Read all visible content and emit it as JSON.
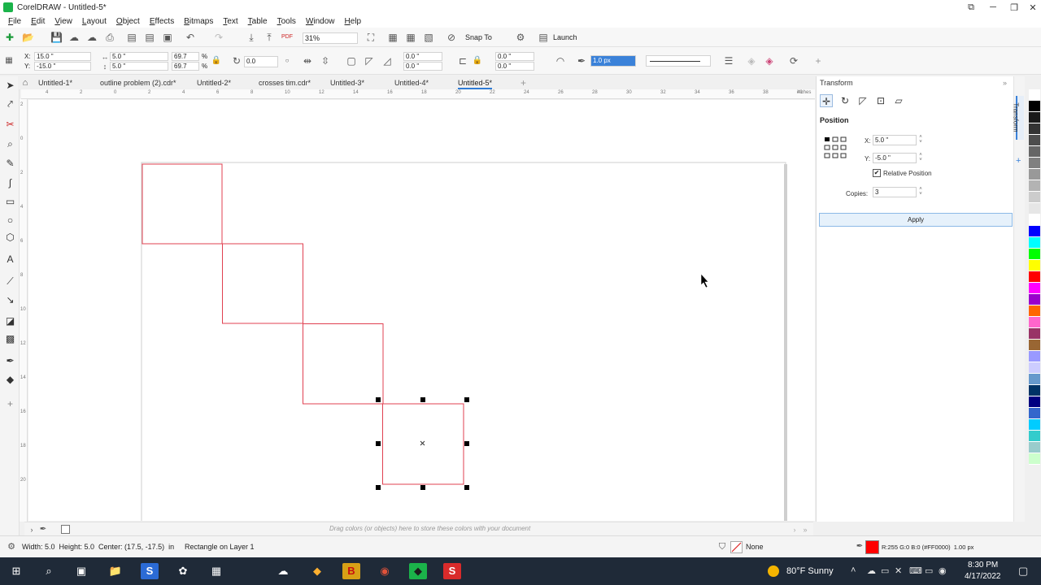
{
  "window": {
    "title": "CorelDRAW - Untitled-5*",
    "controls": {
      "maximize": "⧉",
      "minimize": "─",
      "restore": "❐",
      "close": "✕"
    }
  },
  "menu": [
    "File",
    "Edit",
    "View",
    "Layout",
    "Object",
    "Effects",
    "Bitmaps",
    "Text",
    "Table",
    "Tools",
    "Window",
    "Help"
  ],
  "toolbar": {
    "zoom": "31%",
    "snap_to": "Snap To",
    "launch": "Launch",
    "icons": {
      "new": "✚",
      "open": "📂",
      "save": "💾",
      "undo": "↶",
      "redo": "↷",
      "settings": "⚙",
      "pdf": "PDF"
    }
  },
  "property_bar": {
    "x": "15.0 \"",
    "y": "-15.0 \"",
    "width": "5.0 \"",
    "height": "5.0 \"",
    "scale_w": "69.7",
    "scale_h": "69.7",
    "percent_sign": "%",
    "rotation": "0.0",
    "corner_tl": "0.0 \"",
    "corner_bl": "0.0 \"",
    "corner_tr": "0.0 \"",
    "corner_br": "0.0 \"",
    "outline_width": "1.0 px"
  },
  "doc_tabs": [
    {
      "label": "Untitled-1*",
      "active": false
    },
    {
      "label": "outline problem (2).cdr*",
      "active": false
    },
    {
      "label": "Untitled-2*",
      "active": false
    },
    {
      "label": "crosses tim.cdr*",
      "active": false
    },
    {
      "label": "Untitled-3*",
      "active": false
    },
    {
      "label": "Untitled-4*",
      "active": false
    },
    {
      "label": "Untitled-5*",
      "active": true
    }
  ],
  "add_tab": "+",
  "ruler": {
    "h_ticks": [
      "4",
      "2",
      "0",
      "2",
      "4",
      "6",
      "8",
      "10",
      "12",
      "14",
      "16",
      "18",
      "20",
      "22",
      "24",
      "26",
      "28",
      "30",
      "32",
      "34",
      "36",
      "38",
      "40"
    ],
    "v_ticks": [
      "2",
      "0",
      "2",
      "4",
      "6",
      "8",
      "10",
      "12",
      "14",
      "16",
      "18",
      "20"
    ],
    "unit": "inches"
  },
  "docker": {
    "title": "Transform",
    "section": "Position",
    "x_label": "X:",
    "x_value": "5.0 \"",
    "y_label": "Y:",
    "y_value": "-5.0 \"",
    "relative_label": "Relative Position",
    "relative_checked": true,
    "copies_label": "Copies:",
    "copies_value": "3",
    "apply_label": "Apply",
    "side_tab": "Transform"
  },
  "color_tray": {
    "hint": "Drag colors (or objects) here to store these colors with your document"
  },
  "palette_colors": [
    "#ffffff",
    "#000000",
    "#1a1a1a",
    "#333333",
    "#4d4d4d",
    "#666666",
    "#808080",
    "#999999",
    "#b3b3b3",
    "#cccccc",
    "#e6e6e6",
    "#ffffff",
    "#0000ff",
    "#00ffff",
    "#00ff00",
    "#ffff00",
    "#ff0000",
    "#ff00ff",
    "#9900cc",
    "#ff6600",
    "#ff66cc",
    "#993366",
    "#996633",
    "#9999ff",
    "#ccccff",
    "#6699cc",
    "#003366",
    "#000080",
    "#3366cc",
    "#00ccff",
    "#33cccc",
    "#99cccc",
    "#ccffcc"
  ],
  "status": {
    "dims": "Width: 5.0  Height: 5.0  Center: (17.5, -17.5)  in",
    "layer": "Rectangle on Layer 1",
    "fill": "None",
    "outline": "R:255 G:0 B:0 (#FF0000)  1.00 px",
    "outline_color": "#ff0000"
  },
  "taskbar": {
    "weather": "80°F  Sunny",
    "time": "8:30 PM",
    "date": "4/17/2022",
    "icons": [
      "⊞",
      "⌕",
      "▣",
      "📁",
      "S",
      "✿",
      "☁",
      "◆",
      "B",
      "◉",
      "◆",
      "S"
    ]
  }
}
